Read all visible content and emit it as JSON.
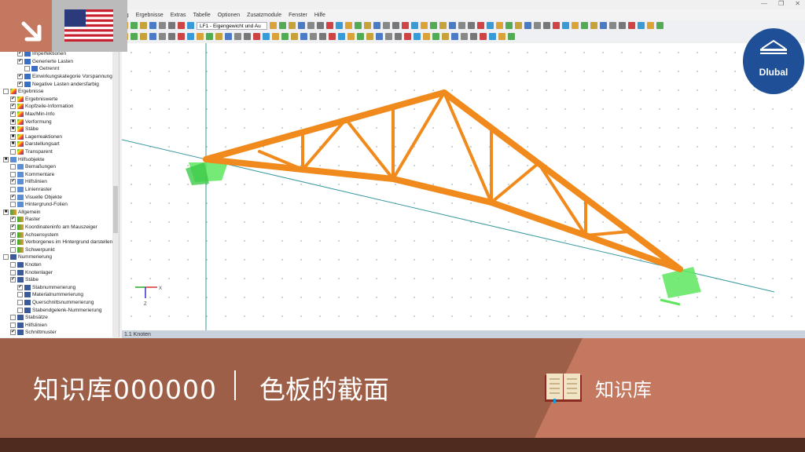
{
  "menu": [
    "ung",
    "Ergebnisse",
    "Extras",
    "Tabelle",
    "Optionen",
    "Zusatzmodule",
    "Fenster",
    "Hilfe"
  ],
  "toolbar": {
    "loadcase": "LF1 - Eigengewicht und Au"
  },
  "tree": [
    {
      "label": "Imperfektionen",
      "lvl": 3,
      "chk": "✔",
      "ic": "load"
    },
    {
      "label": "Generierte Lasten",
      "lvl": 3,
      "chk": "✔",
      "ic": "load"
    },
    {
      "label": "Getrennt",
      "lvl": 4,
      "chk": "",
      "ic": "load"
    },
    {
      "label": "Einwirkungskategorie Vorspannung",
      "lvl": 3,
      "chk": "✔",
      "ic": "load"
    },
    {
      "label": "Negative Lasten andersfarbig",
      "lvl": 3,
      "chk": "✔",
      "ic": "load"
    },
    {
      "label": "Ergebnisse",
      "lvl": 1,
      "chk": "",
      "ic": "res"
    },
    {
      "label": "Ergebniswerte",
      "lvl": 2,
      "chk": "✔",
      "ic": "res"
    },
    {
      "label": "Kopfzeile-Information",
      "lvl": 2,
      "chk": "✔",
      "ic": "res"
    },
    {
      "label": "Max/Min-Info",
      "lvl": 2,
      "chk": "✔",
      "ic": "res"
    },
    {
      "label": "Verformung",
      "lvl": 2,
      "chk": "■",
      "ic": "res"
    },
    {
      "label": "Stäbe",
      "lvl": 2,
      "chk": "■",
      "ic": "res"
    },
    {
      "label": "Lagerreaktionen",
      "lvl": 2,
      "chk": "■",
      "ic": "res"
    },
    {
      "label": "Darstellungsart",
      "lvl": 2,
      "chk": "■",
      "ic": "res"
    },
    {
      "label": "Transparent",
      "lvl": 2,
      "chk": "",
      "ic": "res"
    },
    {
      "label": "Hilfsobjekte",
      "lvl": 1,
      "chk": "■",
      "ic": "aux"
    },
    {
      "label": "Bemaßungen",
      "lvl": 2,
      "chk": "",
      "ic": "aux"
    },
    {
      "label": "Kommentare",
      "lvl": 2,
      "chk": "",
      "ic": "aux"
    },
    {
      "label": "Hilfslinien",
      "lvl": 2,
      "chk": "✔",
      "ic": "aux"
    },
    {
      "label": "Linienraster",
      "lvl": 2,
      "chk": "",
      "ic": "aux"
    },
    {
      "label": "Visuelle Objekte",
      "lvl": 2,
      "chk": "✔",
      "ic": "aux"
    },
    {
      "label": "Hintergrund-Folien",
      "lvl": 2,
      "chk": "",
      "ic": "aux"
    },
    {
      "label": "Allgemein",
      "lvl": 1,
      "chk": "■",
      "ic": "gen"
    },
    {
      "label": "Raster",
      "lvl": 2,
      "chk": "✔",
      "ic": "gen"
    },
    {
      "label": "Koordinateninfo am Mauszeiger",
      "lvl": 2,
      "chk": "✔",
      "ic": "gen"
    },
    {
      "label": "Achsensystem",
      "lvl": 2,
      "chk": "✔",
      "ic": "gen"
    },
    {
      "label": "Verborgenes im Hintergrund darstellen",
      "lvl": 2,
      "chk": "✔",
      "ic": "gen"
    },
    {
      "label": "Schwerpunkt",
      "lvl": 2,
      "chk": "",
      "ic": "gen"
    },
    {
      "label": "Nummerierung",
      "lvl": 1,
      "chk": "",
      "ic": "num"
    },
    {
      "label": "Knoten",
      "lvl": 2,
      "chk": "",
      "ic": "num"
    },
    {
      "label": "Knotenlager",
      "lvl": 2,
      "chk": "",
      "ic": "num"
    },
    {
      "label": "Stäbe",
      "lvl": 2,
      "chk": "✔",
      "ic": "num"
    },
    {
      "label": "Stabnummerierung",
      "lvl": 3,
      "chk": "✔",
      "ic": "num"
    },
    {
      "label": "Materialnummerierung",
      "lvl": 3,
      "chk": "",
      "ic": "num"
    },
    {
      "label": "Querschnittsnummerierung",
      "lvl": 3,
      "chk": "",
      "ic": "num"
    },
    {
      "label": "Stabendgelenk-Nummerierung",
      "lvl": 3,
      "chk": "",
      "ic": "num"
    },
    {
      "label": "Stabsätze",
      "lvl": 2,
      "chk": "",
      "ic": "num"
    },
    {
      "label": "Hilfslinien",
      "lvl": 2,
      "chk": "",
      "ic": "num"
    },
    {
      "label": "Schnittmuster",
      "lvl": 2,
      "chk": "✔",
      "ic": "num"
    }
  ],
  "panel": {
    "title": "1.1 Knoten"
  },
  "axes": {
    "x": "X",
    "z": "Z"
  },
  "logo": {
    "text": "Dlubal"
  },
  "banner": {
    "title": "知识库000000",
    "subtitle": "色板的截面",
    "category": "知识库"
  },
  "colors": {
    "truss": "#f08a1c",
    "support": "#5ee65e",
    "banner": "#9e5f48",
    "accent": "#c47860",
    "footer": "#4e2a1f"
  }
}
